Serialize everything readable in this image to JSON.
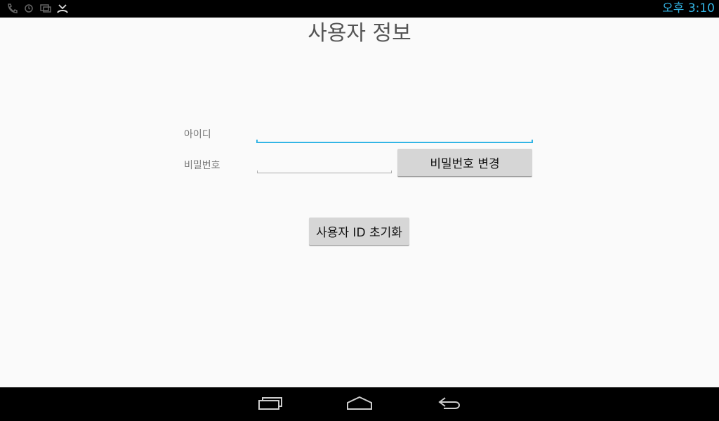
{
  "status_bar": {
    "icons": [
      "phone-icon",
      "sync-icon",
      "screen-icon",
      "missed-call-icon"
    ],
    "time": "오후 3:10",
    "clock_color": "#33b5e5"
  },
  "page": {
    "title": "사용자 정보"
  },
  "form": {
    "id_label": "아이디",
    "id_value": "",
    "password_label": "비밀번호",
    "password_value": "",
    "change_password_button": "비밀번호 변경",
    "reset_user_id_button": "사용자 ID 초기화",
    "focus_color": "#33b5e5"
  },
  "nav_bar": {
    "buttons": [
      "recent-apps-icon",
      "home-icon",
      "back-icon"
    ]
  }
}
